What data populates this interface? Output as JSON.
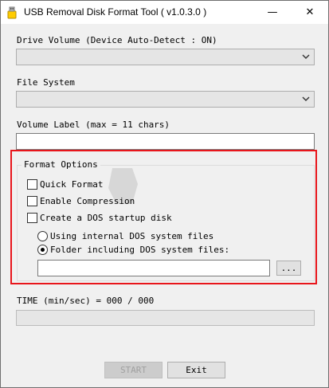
{
  "window": {
    "title": "USB Removal Disk Format Tool ( v1.0.3.0 )",
    "minimize_glyph": "—",
    "close_glyph": "✕"
  },
  "drive_volume": {
    "label": "Drive Volume  (Device Auto-Detect : ON)",
    "selected": ""
  },
  "file_system": {
    "label": "File System",
    "selected": ""
  },
  "volume_label": {
    "label": "Volume Label (max = 11 chars)",
    "value": ""
  },
  "format_options": {
    "title": "Format Options",
    "quick_format": {
      "label": "Quick Format",
      "checked": false
    },
    "enable_compression": {
      "label": "Enable Compression",
      "checked": false
    },
    "create_dos_disk": {
      "label": "Create a DOS startup disk",
      "checked": false
    },
    "radio_internal": {
      "label": "Using internal DOS system files",
      "selected": false
    },
    "radio_folder": {
      "label": "Folder including DOS system files:",
      "selected": true
    },
    "folder_path": "",
    "browse_label": "..."
  },
  "time": {
    "label": "TIME (min/sec) = 000 / 000"
  },
  "progress": {
    "fraction": 0
  },
  "buttons": {
    "start": "START",
    "exit": "Exit"
  },
  "colors": {
    "highlight_border": "#e8151b",
    "window_bg": "#f0f0f0"
  }
}
